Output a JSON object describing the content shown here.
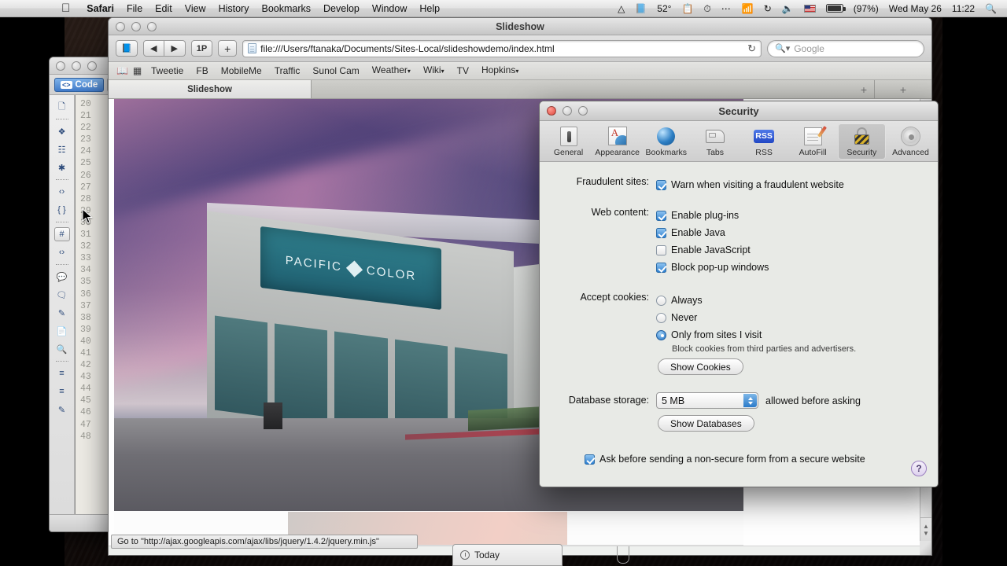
{
  "menubar": {
    "apple_icon": "apple-icon",
    "items": [
      {
        "label": "Safari",
        "bold": true
      },
      {
        "label": "File",
        "bold": false
      },
      {
        "label": "Edit",
        "bold": false
      },
      {
        "label": "View",
        "bold": false
      },
      {
        "label": "History",
        "bold": false
      },
      {
        "label": "Bookmarks",
        "bold": false
      },
      {
        "label": "Develop",
        "bold": false
      },
      {
        "label": "Window",
        "bold": false
      },
      {
        "label": "Help",
        "bold": false
      }
    ],
    "status": {
      "dropbox_icon": "dropbox-icon",
      "evernote_icon": "evernote-icon",
      "temperature": "52°",
      "clock_icon": "clock-icon",
      "ellipsis_icon": "ellipsis-icon",
      "wifi_icon": "wifi-icon",
      "sync_icon": "sync-icon",
      "volume_icon": "volume-icon",
      "flag_icon": "us-flag-icon",
      "battery_icon": "battery-icon",
      "battery_percent": "(97%)",
      "date": "Wed May 26",
      "time": "11:22",
      "spotlight_icon": "search-icon"
    }
  },
  "code_editor": {
    "tab_label": "Code",
    "tab_glyph": "<>",
    "tools": [
      "new-document-icon",
      "wrap-tag-icon",
      "select-parent-tag-icon",
      "collapse-selection-icon",
      "remove-comment-icon",
      "apply-braces-icon",
      "highlight-invalid-icon",
      "validate-code-icon",
      "comment-balloon-icon",
      "server-comment-icon",
      "refactor-icon",
      "snippet-icon",
      "search-code-icon",
      "indent-icon",
      "outdent-icon",
      "format-source-icon"
    ],
    "line_numbers": [
      "20",
      "21",
      "22",
      "23",
      "24",
      "25",
      "26",
      "27",
      "28",
      "29",
      "30",
      "31",
      "32",
      "33",
      "34",
      "35",
      "36",
      "37",
      "38",
      "39",
      "40",
      "41",
      "42",
      "43",
      "44",
      "45",
      "46",
      "47",
      "48"
    ]
  },
  "safari": {
    "window_title": "Slideshow",
    "toolbar": {
      "evernote_label": "evernote-clip-icon",
      "back_label": "◀",
      "forward_label": "▶",
      "onepassword_label": "1P",
      "add_label": "+",
      "url": "file:///Users/ftanaka/Documents/Sites-Local/slideshowdemo/index.html",
      "reload_label": "↻",
      "search_placeholder": "Google",
      "search_icon": "search-icon"
    },
    "bookmarks": {
      "book_icon": "bookmarks-book-icon",
      "grid_icon": "top-sites-grid-icon",
      "items": [
        {
          "label": "Tweetie",
          "menu": false
        },
        {
          "label": "FB",
          "menu": false
        },
        {
          "label": "MobileMe",
          "menu": false
        },
        {
          "label": "Traffic",
          "menu": false
        },
        {
          "label": "Sunol Cam",
          "menu": false
        },
        {
          "label": "Weather",
          "menu": true
        },
        {
          "label": "Wiki",
          "menu": true
        },
        {
          "label": "TV",
          "menu": false
        },
        {
          "label": "Hopkins",
          "menu": true
        }
      ]
    },
    "tabs": {
      "active_tab": "Slideshow",
      "new_tab_label": "+"
    },
    "page": {
      "sign_left": "PACIFIC",
      "sign_right": "COLOR",
      "sign_diamond": "diamond-icon"
    },
    "status_message": "Go to \"http://ajax.googleapis.com/ajax/libs/jquery/1.4.2/jquery.min.js\""
  },
  "ical_sliver": {
    "label": "Today",
    "clock_icon": "clock-icon"
  },
  "prefs": {
    "title": "Security",
    "toolbar": [
      {
        "label": "General",
        "icon": "general-icon",
        "selected": false
      },
      {
        "label": "Appearance",
        "icon": "appearance-icon",
        "selected": false
      },
      {
        "label": "Bookmarks",
        "icon": "bookmarks-globe-icon",
        "selected": false
      },
      {
        "label": "Tabs",
        "icon": "tabs-icon",
        "selected": false
      },
      {
        "label": "RSS",
        "icon": "rss-icon",
        "selected": false
      },
      {
        "label": "AutoFill",
        "icon": "autofill-icon",
        "selected": false
      },
      {
        "label": "Security",
        "icon": "lock-icon",
        "selected": true
      },
      {
        "label": "Advanced",
        "icon": "gear-icon",
        "selected": false
      }
    ],
    "fraudulent": {
      "label": "Fraudulent sites:",
      "checkbox_label": "Warn when visiting a fraudulent website",
      "checked": true
    },
    "web_content": {
      "label": "Web content:",
      "options": [
        {
          "label": "Enable plug-ins",
          "checked": true
        },
        {
          "label": "Enable Java",
          "checked": true
        },
        {
          "label": "Enable JavaScript",
          "checked": false
        },
        {
          "label": "Block pop-up windows",
          "checked": true
        }
      ]
    },
    "cookies": {
      "label": "Accept cookies:",
      "options": [
        {
          "label": "Always",
          "selected": false
        },
        {
          "label": "Never",
          "selected": false
        },
        {
          "label": "Only from sites I visit",
          "selected": true
        }
      ],
      "note": "Block cookies from third parties and advertisers.",
      "show_button": "Show Cookies"
    },
    "database": {
      "label": "Database storage:",
      "value": "5 MB",
      "suffix": "allowed before asking",
      "show_button": "Show Databases"
    },
    "nonsecure": {
      "label": "Ask before sending a non-secure form from a secure website",
      "checked": true
    },
    "help_label": "?"
  },
  "colors": {
    "accent_blue": "#2d7fd0",
    "menubar_bg": "#e3e3e3",
    "prefs_bg": "#e8eae6",
    "selected_tab": "#3f79c8"
  }
}
